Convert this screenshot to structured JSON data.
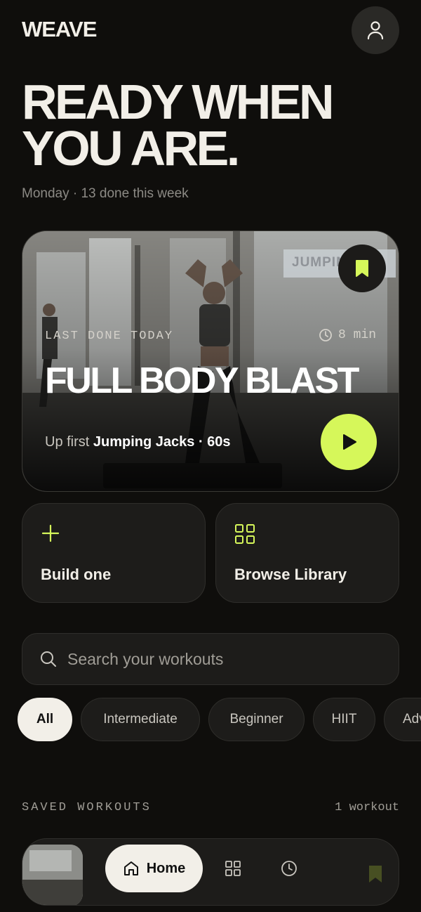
{
  "header": {
    "brand": "WEAVE",
    "headline_line1": "READY WHEN",
    "headline_line2": "YOU ARE.",
    "subtitle": "Monday · 13 done this week"
  },
  "hero": {
    "meta": "LAST DONE TODAY",
    "duration": "8 min",
    "title": "FULL BODY BLAST",
    "up_first_prefix": "Up first",
    "up_first_exercise": "Jumping Jacks · 60s",
    "sign_text": "JUMPING"
  },
  "actions": {
    "build_label": "Build one",
    "browse_label": "Browse Library"
  },
  "search": {
    "placeholder": "Search your workouts"
  },
  "filters": [
    "All",
    "Intermediate",
    "Beginner",
    "HIIT",
    "Adv"
  ],
  "saved": {
    "heading": "SAVED WORKOUTS",
    "count": "1 workout"
  },
  "nav": {
    "home_label": "Home"
  },
  "colors": {
    "background": "#0f0e0c",
    "accent": "#d6f75a",
    "surface": "#1d1c1a",
    "text": "#f2efe8",
    "muted": "#8c8a85"
  },
  "icons": {
    "profile": "user-icon",
    "bookmark": "bookmark-icon",
    "clock": "clock-icon",
    "play": "play-icon",
    "plus": "plus-icon",
    "grid": "grid-icon",
    "search": "search-icon",
    "home": "home-icon",
    "history": "clock-icon"
  }
}
